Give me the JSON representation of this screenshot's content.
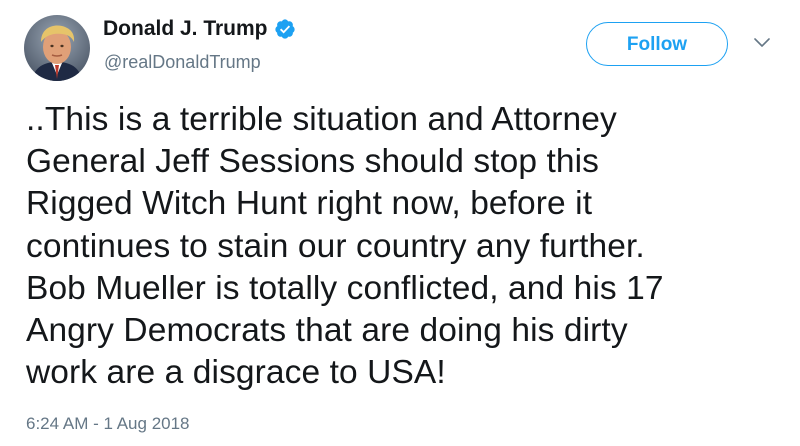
{
  "author": {
    "display_name": "Donald J. Trump",
    "handle": "@realDonaldTrump",
    "verified": true,
    "avatar_icon": "profile-photo"
  },
  "actions": {
    "follow_label": "Follow",
    "menu_icon": "chevron-down-icon"
  },
  "tweet": {
    "text": "..This is a terrible situation and Attorney\nGeneral Jeff Sessions should stop this\nRigged Witch Hunt right now, before it\ncontinues to stain our country any further.\nBob Mueller is totally conflicted, and his 17\nAngry Democrats that are doing his dirty\nwork are a disgrace to USA!",
    "timestamp": "6:24 AM - 1 Aug 2018"
  },
  "colors": {
    "accent": "#1da1f2",
    "text": "#14171a",
    "secondary": "#657786"
  }
}
